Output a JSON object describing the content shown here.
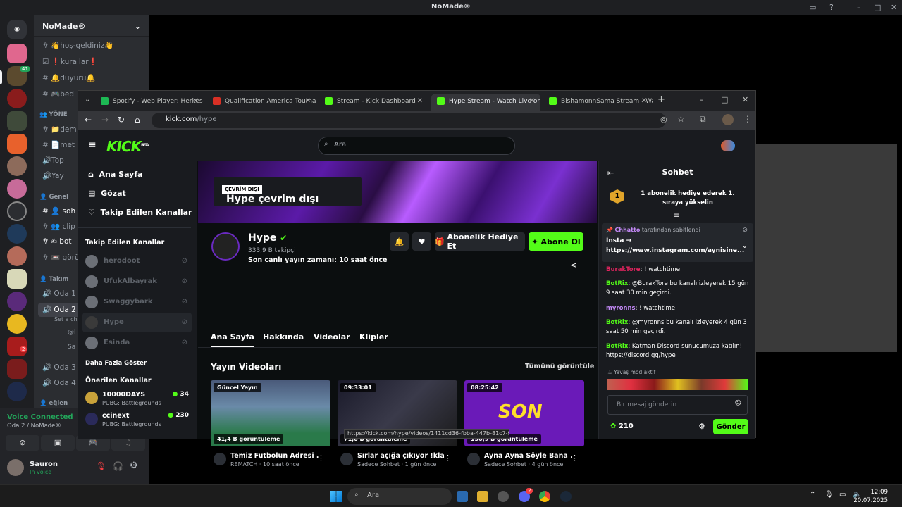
{
  "discord": {
    "window_title": "NoMade®",
    "server_name": "NoMade®",
    "channels": [
      "👋hoş-geldiniz👋",
      "❗kurallar❗",
      "🔔duyuru🔔",
      "🎮bed"
    ],
    "category_1": "👥 YÖNE",
    "channels_2": [
      "📁dem",
      "📄met",
      "🔊Top",
      "🔊Yay"
    ],
    "category_2": "👤 Genel",
    "channels_3": [
      "👤 soh",
      "👥 clip",
      "✍ bot",
      "📼 görü"
    ],
    "category_3": "👤 Takım",
    "voice_channels": [
      "Oda 1",
      "Oda 2",
      "Oda 3",
      "Oda 4"
    ],
    "set_a_chat": "Set a cha",
    "voice_users": [
      "@l",
      "Sa"
    ],
    "category_4": "👤 eğlen",
    "voice_connected": "Voice Connected",
    "voice_location": "Oda 2 / NoMade®",
    "username": "Sauron",
    "user_status": "In voice",
    "mention_badge": "41",
    "badge_2": "2"
  },
  "browser": {
    "tabs": [
      {
        "label": "Spotify - Web Player: Herkes için",
        "color": "#1db954"
      },
      {
        "label": "Qualification America Tournament",
        "color": "#d93025"
      },
      {
        "label": "Stream - Kick Dashboard",
        "color": "#53fc18"
      },
      {
        "label": "Hype Stream - Watch Live on Kick",
        "color": "#53fc18"
      },
      {
        "label": "BishamonnSama Stream - Watch",
        "color": "#53fc18"
      }
    ],
    "url_host": "kick.com",
    "url_path": "/hype",
    "status_url": "https://kick.com/hype/videos/1411cd36-fbba-447b-81c7-9ce527fd29f1"
  },
  "kick": {
    "logo": "KICK",
    "logo_beta": "BETA",
    "search_placeholder": "Ara",
    "nav": [
      "Ana Sayfa",
      "Gözat",
      "Takip Edilen Kanallar"
    ],
    "followed_title": "Takip Edilen Kanallar",
    "followed": [
      "herodoot",
      "UfukAlbayrak",
      "Swaggybark",
      "Hype",
      "Esinda"
    ],
    "show_more": "Daha Fazla Göster",
    "recommended_title": "Önerilen Kanallar",
    "recommended": [
      {
        "name": "10000DAYS",
        "game": "PUBG: Battlegrounds",
        "viewers": "34"
      },
      {
        "name": "ccinext",
        "game": "PUBG: Battlegrounds",
        "viewers": "230"
      }
    ],
    "offline_tag": "ÇEVRİM DIŞI",
    "offline_title": "Hype çevrim dışı",
    "channel_name": "Hype",
    "followers": "333,9 B takipçi",
    "last_live": "Son canlı yayın zamanı: 10 saat önce",
    "gift_sub": "Abonelik Hediye Et",
    "subscribe": "Abone Ol",
    "tabs": [
      "Ana Sayfa",
      "Hakkında",
      "Videolar",
      "Klipler"
    ],
    "videos_title": "Yayın Videoları",
    "see_all": "Tümünü görüntüle",
    "videos": [
      {
        "badge": "Güncel Yayın",
        "views": "41,4 B görüntüleme",
        "title": "Temiz Futbolun Adresi ...",
        "sub": "REMATCH · 10 saat önce"
      },
      {
        "badge": "09:33:01",
        "views": "71,6 B görüntüleme",
        "title": "Sırlar açığa çıkıyor !kla...",
        "sub": "Sadece Sohbet · 1 gün önce"
      },
      {
        "badge": "08:25:42",
        "views": "130,9 B görüntüleme",
        "title": "Ayna Ayna Söyle Bana ...",
        "sub": "Sadece Sohbet · 4 gün önce",
        "thumb_text": "SON"
      }
    ]
  },
  "chat": {
    "title": "Sohbet",
    "gift_rank": "1",
    "gift_text": "1 abonelik hediye ederek 1. sıraya yükselin",
    "pinned_by": "Chhatto",
    "pinned_suffix": "tarafından sabitlendi",
    "pinned_text": "İnsta →",
    "pinned_link": "https://www.instagram.com/aynisine...",
    "messages": [
      {
        "user": "BurakTore",
        "color": "#e0245e",
        "text": ": ! watchtime"
      },
      {
        "user": "BotRix",
        "color": "#53fc18",
        "text": ": @BurakTore bu kanalı izleyerek 15 gün 9 saat 30 min geçirdi."
      },
      {
        "user": "myronns",
        "color": "#c58af9",
        "text": ": ! watchtime"
      },
      {
        "user": "BotRix",
        "color": "#53fc18",
        "text": ": @myronns bu kanalı izleyerek 4 gün 3 saat 50 min geçirdi."
      },
      {
        "user": "BotRix",
        "color": "#53fc18",
        "text": ": Katman Discord sunucumuza katılın! ",
        "link": "https://discord.gg/hype"
      }
    ],
    "slow_mode": "Yavaş mod aktif",
    "input_placeholder": "Bir mesaj gönderin",
    "points": "210",
    "send": "Gönder"
  },
  "taskbar": {
    "search": "Ara",
    "time": "12:09",
    "date": "20.07.2025",
    "discord_badge": "2"
  }
}
